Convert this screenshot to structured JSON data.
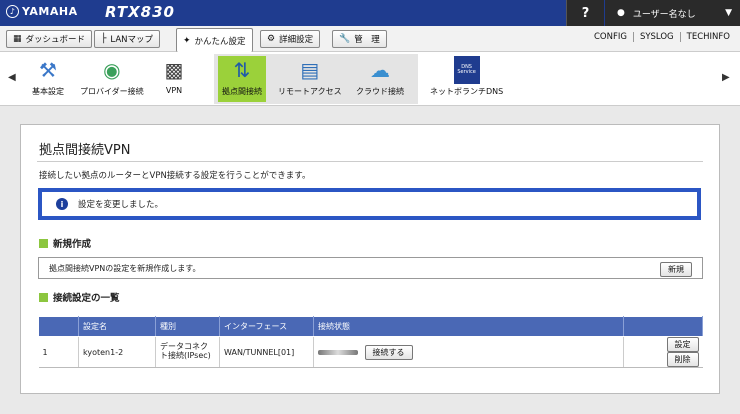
{
  "header": {
    "brand": "YAMAHA",
    "model": "RTX830",
    "help": "?",
    "user": "ユーザー名なし"
  },
  "nav": {
    "buttons": [
      {
        "label": "ダッシュボード",
        "icon": "dashboard-icon"
      },
      {
        "label": "LANマップ",
        "icon": "lan-map-icon"
      },
      {
        "label": "かんたん設定",
        "icon": "wizard-icon"
      },
      {
        "label": "詳細設定",
        "icon": "gear-icon"
      },
      {
        "label": "管　理",
        "icon": "wrench-icon"
      }
    ],
    "links": [
      "CONFIG",
      "SYSLOG",
      "TECHINFO"
    ]
  },
  "tiles": [
    {
      "label": "基本設定",
      "icon": "tools-icon"
    },
    {
      "label": "プロバイダー接続",
      "icon": "globe-icon"
    },
    {
      "label": "VPN",
      "icon": "vpn-lock-icon"
    },
    {
      "label": "拠点間接続",
      "icon": "site-to-site-icon"
    },
    {
      "label": "リモートアクセス",
      "icon": "remote-access-icon"
    },
    {
      "label": "クラウド接続",
      "icon": "cloud-icon"
    },
    {
      "label": "ネットボランチDNS",
      "icon": "dns-service-icon",
      "badge": "DNS Service"
    }
  ],
  "page": {
    "title": "拠点間接続VPN",
    "description": "接続したい拠点のルーターとVPN接続する設定を行うことができます。",
    "notice": "設定を変更しました。",
    "new_section": {
      "title": "新規作成",
      "text": "拠点間接続VPNの設定を新規作成します。",
      "button": "新規"
    },
    "list_section": {
      "title": "接続設定の一覧",
      "columns": [
        "",
        "設定名",
        "種別",
        "インターフェース",
        "接続状態",
        ""
      ],
      "rows": [
        {
          "no": "1",
          "name": "kyoten1-2",
          "type": "データコネクト接続(IPsec)",
          "interface": "WAN/TUNNEL[01]",
          "connect_button": "接続する",
          "edit_button": "設定",
          "delete_button": "削除"
        }
      ]
    }
  }
}
